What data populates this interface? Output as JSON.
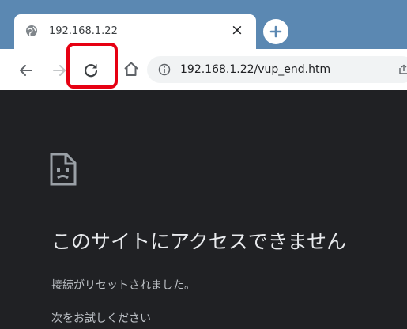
{
  "tab": {
    "title": "192.168.1.22",
    "close_glyph": "×",
    "favicon": "globe-icon"
  },
  "toolbar": {
    "back_icon": "arrow-left-icon",
    "forward_icon": "arrow-right-icon",
    "reload_icon": "reload-icon",
    "home_icon": "home-icon",
    "highlight_color": "#e60012"
  },
  "omnibox": {
    "host": "192.168.1.22",
    "path": "/vup_end.htm"
  },
  "error_page": {
    "heading": "このサイトにアクセスできません",
    "description": "接続がリセットされました。",
    "suggestion": "次をお試しください"
  },
  "colors": {
    "tabstrip": "#5b88b2",
    "page_background": "#202124"
  }
}
